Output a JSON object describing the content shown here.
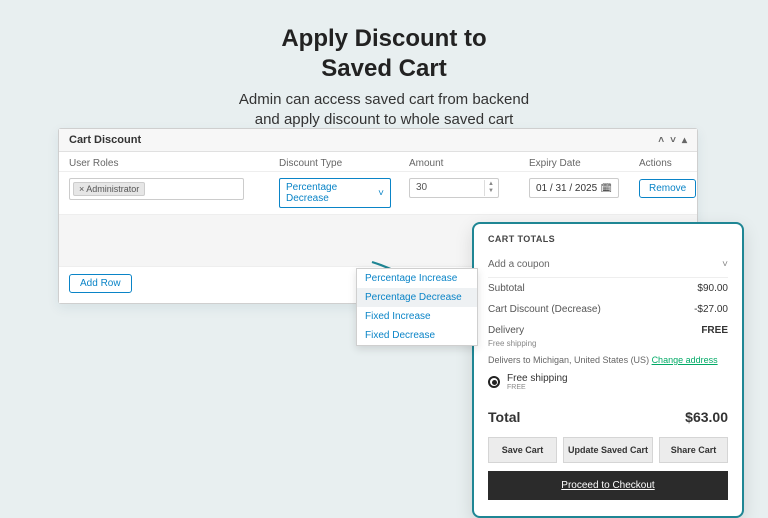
{
  "heading": {
    "title_l1": "Apply Discount to",
    "title_l2": "Saved Cart",
    "subtitle_l1": "Admin can access saved cart from backend",
    "subtitle_l2": "and apply discount to whole saved cart"
  },
  "panel": {
    "title": "Cart Discount",
    "columns": [
      "User Roles",
      "Discount Type",
      "Amount",
      "Expiry Date",
      "Actions"
    ],
    "row": {
      "role_tag": "× Administrator",
      "discount_type_selected": "Percentage Decrease",
      "amount": "30",
      "expiry": "01 / 31 / 2025",
      "remove": "Remove"
    },
    "dropdown_options": [
      "Percentage Increase",
      "Percentage Decrease",
      "Fixed Increase",
      "Fixed Decrease"
    ],
    "add_row": "Add Row"
  },
  "cart": {
    "title": "CART TOTALS",
    "coupon_label": "Add a coupon",
    "subtotal_label": "Subtotal",
    "subtotal_value": "$90.00",
    "discount_label": "Cart Discount (Decrease)",
    "discount_value": "-$27.00",
    "delivery_label": "Delivery",
    "delivery_value": "FREE",
    "delivery_note": "Free shipping",
    "delivers_to_prefix": "Delivers to Michigan, United States (US) ",
    "change_address": "Change address",
    "ship_option": "Free shipping",
    "ship_option_sub": "FREE",
    "total_label": "Total",
    "total_value": "$63.00",
    "save_cart": "Save Cart",
    "update_cart": "Update Saved Cart",
    "share_cart": "Share Cart",
    "checkout": "Proceed to Checkout"
  }
}
